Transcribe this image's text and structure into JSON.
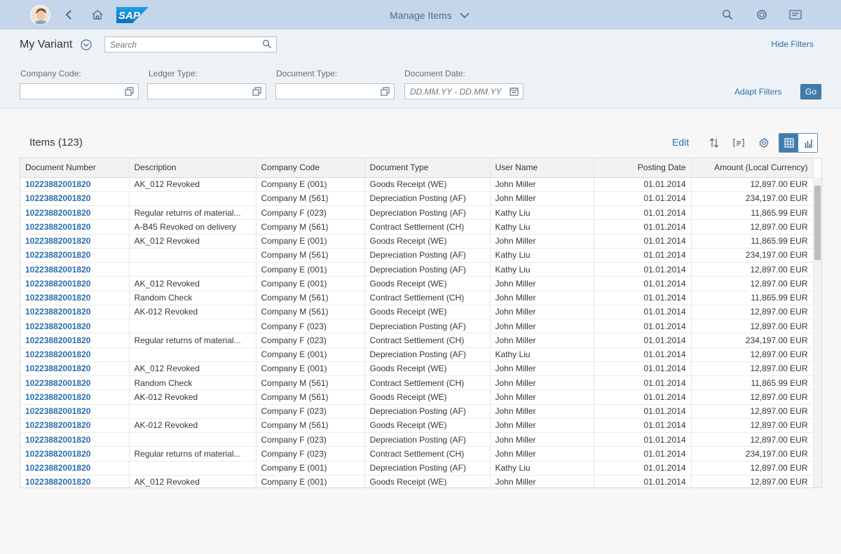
{
  "shell": {
    "title": "Manage Items",
    "logo_text": "SAP",
    "icons": [
      "user-avatar",
      "back-icon",
      "home-icon",
      "search-icon",
      "copilot-icon",
      "notifications-icon"
    ]
  },
  "filterbar": {
    "variant": "My Variant",
    "search_placeholder": "Search",
    "hide_filters": "Hide Filters",
    "filters": [
      {
        "label": "Company Code:",
        "value": "",
        "placeholder": ""
      },
      {
        "label": "Ledger Type:",
        "value": "",
        "placeholder": ""
      },
      {
        "label": "Document Type:",
        "value": "",
        "placeholder": ""
      },
      {
        "label": "Document Date:",
        "value": "",
        "placeholder": "DD.MM.YY - DD.MM.YY"
      }
    ],
    "adapt_filters": "Adapt Filters",
    "go": "Go"
  },
  "table": {
    "title": "Items (123)",
    "edit": "Edit",
    "columns": [
      "Document Number",
      "Description",
      "Company Code",
      "Document Type",
      "User Name",
      "Posting Date",
      "Amount (Local Currency)"
    ],
    "rows": [
      [
        "10223882001820",
        "AK_012 Revoked",
        "Company E (001)",
        "Goods Receipt (WE)",
        "John Miller",
        "01.01.2014",
        "12,897.00 EUR"
      ],
      [
        "10223882001820",
        "",
        "Company M (561)",
        "Depreciation Posting (AF)",
        "John Miller",
        "01.01.2014",
        "234,197.00 EUR"
      ],
      [
        "10223882001820",
        "Regular returns of material...",
        "Company F (023)",
        "Depreciation Posting (AF)",
        "Kathy Liu",
        "01.01.2014",
        "11,865.99 EUR"
      ],
      [
        "10223882001820",
        "A-B45 Revoked on delivery",
        "Company M (561)",
        "Contract Settlement (CH)",
        "Kathy Liu",
        "01.01.2014",
        "12,897.00 EUR"
      ],
      [
        "10223882001820",
        "AK_012 Revoked",
        "Company E (001)",
        "Goods Receipt (WE)",
        "John Miller",
        "01.01.2014",
        "11,865.99 EUR"
      ],
      [
        "10223882001820",
        "",
        "Company M (561)",
        "Depreciation Posting (AF)",
        "Kathy Liu",
        "01.01.2014",
        "234,197.00 EUR"
      ],
      [
        "10223882001820",
        "",
        "Company E (001)",
        "Depreciation Posting (AF)",
        "Kathy Liu",
        "01.01.2014",
        "12,897.00 EUR"
      ],
      [
        "10223882001820",
        "AK_012 Revoked",
        "Company E (001)",
        "Goods Receipt (WE)",
        "John Miller",
        "01.01.2014",
        "12,897.00 EUR"
      ],
      [
        "10223882001820",
        "Random Check",
        "Company M (561)",
        "Contract Settlement (CH)",
        "John Miller",
        "01.01.2014",
        "11,865.99 EUR"
      ],
      [
        "10223882001820",
        "AK-012 Revoked",
        "Company M (561)",
        "Goods Receipt (WE)",
        "John Miller",
        "01.01.2014",
        "12,897.00 EUR"
      ],
      [
        "10223882001820",
        "",
        "Company F (023)",
        "Depreciation Posting (AF)",
        "John Miller",
        "01.01.2014",
        "12,897.00 EUR"
      ],
      [
        "10223882001820",
        "Regular returns of material...",
        "Company F (023)",
        "Contract Settlement (CH)",
        "John Miller",
        "01.01.2014",
        "234,197.00 EUR"
      ],
      [
        "10223882001820",
        "",
        "Company E (001)",
        "Depreciation Posting (AF)",
        "Kathy Liu",
        "01.01.2014",
        "12,897.00 EUR"
      ],
      [
        "10223882001820",
        "AK_012 Revoked",
        "Company E (001)",
        "Goods Receipt (WE)",
        "John Miller",
        "01.01.2014",
        "12,897.00 EUR"
      ],
      [
        "10223882001820",
        "Random Check",
        "Company M (561)",
        "Contract Settlement (CH)",
        "John Miller",
        "01.01.2014",
        "11,865.99 EUR"
      ],
      [
        "10223882001820",
        "AK-012 Revoked",
        "Company M (561)",
        "Goods Receipt (WE)",
        "John Miller",
        "01.01.2014",
        "12,897.00 EUR"
      ],
      [
        "10223882001820",
        "",
        "Company F (023)",
        "Depreciation Posting (AF)",
        "John Miller",
        "01.01.2014",
        "12,897.00 EUR"
      ],
      [
        "10223882001820",
        "AK-012 Revoked",
        "Company M (561)",
        "Goods Receipt (WE)",
        "John Miller",
        "01.01.2014",
        "12,897.00 EUR"
      ],
      [
        "10223882001820",
        "",
        "Company F (023)",
        "Depreciation Posting (AF)",
        "John Miller",
        "01.01.2014",
        "12,897.00 EUR"
      ],
      [
        "10223882001820",
        "Regular returns of material...",
        "Company F (023)",
        "Contract Settlement (CH)",
        "John Miller",
        "01.01.2014",
        "234,197.00 EUR"
      ],
      [
        "10223882001820",
        "",
        "Company E (001)",
        "Depreciation Posting (AF)",
        "Kathy Liu",
        "01.01.2014",
        "12,897.00 EUR"
      ],
      [
        "10223882001820",
        "AK_012 Revoked",
        "Company E (001)",
        "Goods Receipt (WE)",
        "John Miller",
        "01.01.2014",
        "12,897.00 EUR"
      ]
    ]
  },
  "colors": {
    "shell": "#c5d6ea",
    "link": "#2a6eb0",
    "accent": "#427cac"
  }
}
